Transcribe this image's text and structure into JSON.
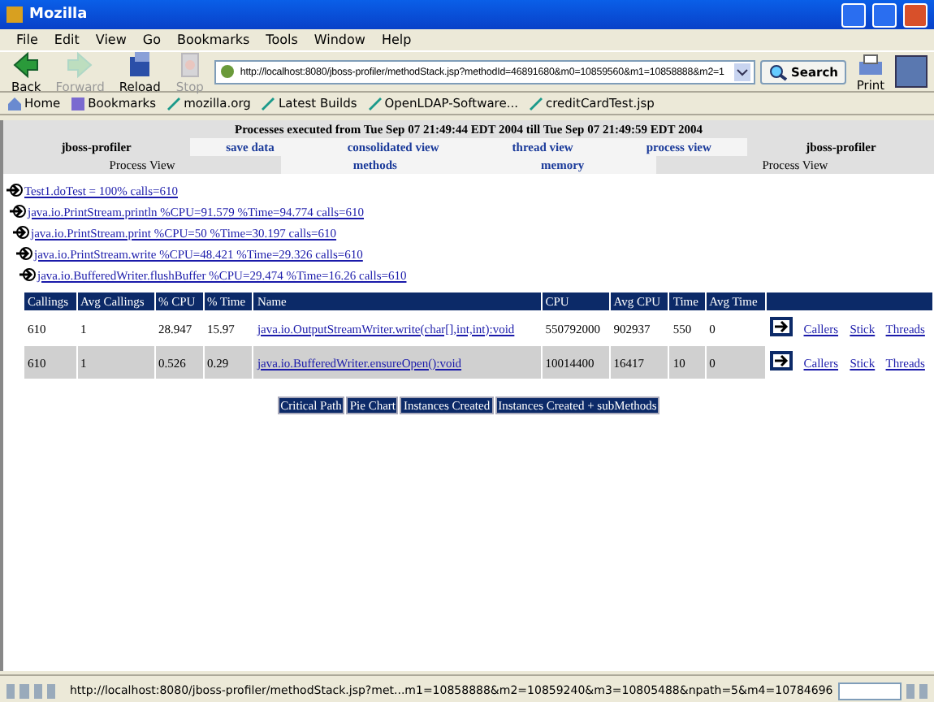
{
  "window": {
    "title": "Mozilla"
  },
  "menu": [
    "File",
    "Edit",
    "View",
    "Go",
    "Bookmarks",
    "Tools",
    "Window",
    "Help"
  ],
  "toolbar": {
    "buttons": [
      {
        "label": "Back",
        "kind": "back",
        "disabled": false
      },
      {
        "label": "Forward",
        "kind": "forward",
        "disabled": true
      },
      {
        "label": "Reload",
        "kind": "reload",
        "disabled": false
      },
      {
        "label": "Stop",
        "kind": "stop",
        "disabled": true
      }
    ],
    "address": {
      "value": "http://localhost:8080/jboss-profiler/methodStack.jsp?methodId=46891680&m0=10859560&m1=10858888&m2=1"
    },
    "search_button": "Search",
    "print_button": "Print"
  },
  "bookmarks": [
    {
      "label": "Home",
      "kind": "home"
    },
    {
      "label": "Bookmarks",
      "kind": "bookmarks"
    },
    {
      "label": "mozilla.org",
      "kind": "page"
    },
    {
      "label": "Latest Builds",
      "kind": "page"
    },
    {
      "label": "OpenLDAP-Software...",
      "kind": "page"
    },
    {
      "label": "creditCardTest.jsp",
      "kind": "page"
    }
  ],
  "page": {
    "header": "Processes executed from Tue Sep 07 21:49:44 EDT 2004 till Tue Sep 07 21:49:59 EDT 2004",
    "nav_rows": [
      [
        {
          "label": "jboss-profiler",
          "kind": "title"
        },
        {
          "label": "save data",
          "kind": "link"
        },
        {
          "label": "consolidated view",
          "kind": "link"
        },
        {
          "label": "thread view",
          "kind": "link"
        },
        {
          "label": "process view",
          "kind": "link"
        },
        {
          "label": "jboss-profiler",
          "kind": "title"
        }
      ],
      [
        {
          "label": "Process View",
          "kind": "label"
        },
        {
          "label": "methods",
          "kind": "link"
        },
        {
          "label": "memory",
          "kind": "link"
        },
        {
          "label": "Process View",
          "kind": "label"
        }
      ]
    ],
    "tree": [
      {
        "label": "Test1.doTest = 100% calls=610",
        "children": [
          {
            "label": "java.io.PrintStream.println %CPU=91.579 %Time=94.774 calls=610",
            "children": [
              {
                "label": "java.io.PrintStream.print %CPU=50 %Time=30.197 calls=610",
                "children": [
                  {
                    "label": "java.io.PrintStream.write %CPU=48.421 %Time=29.326 calls=610",
                    "children": [
                      {
                        "label": "java.io.BufferedWriter.flushBuffer %CPU=29.474 %Time=16.26 calls=610"
                      }
                    ]
                  }
                ]
              }
            ]
          }
        ]
      }
    ],
    "table": {
      "columns": [
        "Callings",
        "Avg Callings",
        "% CPU",
        "% Time",
        "Name",
        "CPU",
        "Avg CPU",
        "Time",
        "Avg Time"
      ],
      "rows": [
        {
          "cells": [
            "610",
            "1",
            "28.947",
            "15.97",
            "java.io.OutputStreamWriter.write(char[],int,int):void",
            "550792000",
            "902937",
            "550",
            "0"
          ],
          "actions": [
            "Callers",
            "Stick",
            "Threads"
          ]
        },
        {
          "cells": [
            "610",
            "1",
            "0.526",
            "0.29",
            "java.io.BufferedWriter.ensureOpen():void",
            "10014400",
            "16417",
            "10",
            "0"
          ],
          "actions": [
            "Callers",
            "Stick",
            "Threads"
          ]
        }
      ]
    },
    "buttons": [
      "Critical Path",
      "Pie Chart",
      "Instances Created",
      "Instances Created + subMethods"
    ]
  },
  "status_bar": {
    "url": "http://localhost:8080/jboss-profiler/methodStack.jsp?met...m1=10858888&m2=10859240&m3=10805488&npath=5&m4=10784696"
  }
}
